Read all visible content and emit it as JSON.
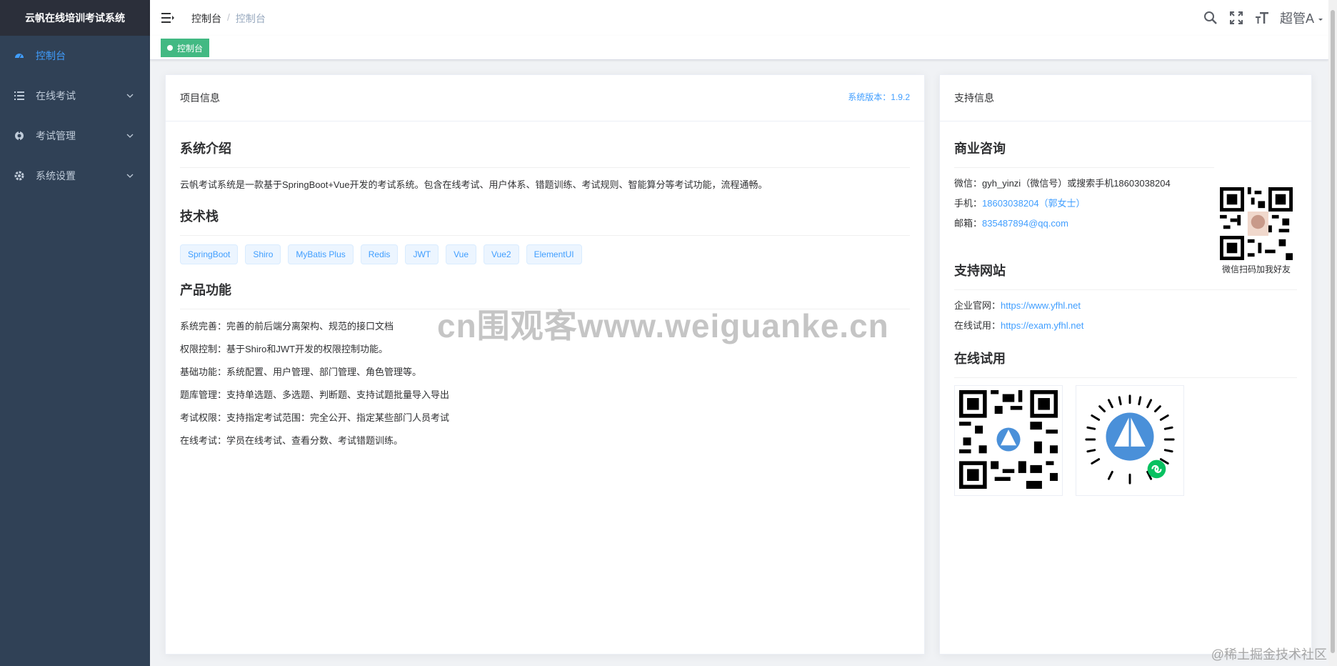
{
  "app": {
    "logo_text": "云帆在线培训考试系统"
  },
  "sidebar": {
    "items": [
      {
        "label": "控制台",
        "icon": "dashboard-icon",
        "active": true
      },
      {
        "label": "在线考试",
        "icon": "list-icon"
      },
      {
        "label": "考试管理",
        "icon": "gear-outline-icon"
      },
      {
        "label": "系统设置",
        "icon": "gear-icon"
      }
    ]
  },
  "navbar": {
    "breadcrumb": [
      "控制台",
      "控制台"
    ],
    "breadcrumb_sep": "/",
    "user_name": "超管A"
  },
  "tags_view": {
    "active_tag": "控制台"
  },
  "project_card": {
    "header": "项目信息",
    "version": "系统版本：1.9.2",
    "intro_title": "系统介绍",
    "intro_text": "云帆考试系统是一款基于SpringBoot+Vue开发的考试系统。包含在线考试、用户体系、错题训练、考试规则、智能算分等考试功能，流程通畅。",
    "tech_title": "技术栈",
    "tech_tags": [
      "SpringBoot",
      "Shiro",
      "MyBatis Plus",
      "Redis",
      "JWT",
      "Vue",
      "Vue2",
      "ElementUI"
    ],
    "features_title": "产品功能",
    "features": [
      "系统完善：完善的前后端分离架构、规范的接口文档",
      "权限控制：基于Shiro和JWT开发的权限控制功能。",
      "基础功能：系统配置、用户管理、部门管理、角色管理等。",
      "题库管理：支持单选题、多选题、判断题、支持试题批量导入导出",
      "考试权限：支持指定考试范围：完全公开、指定某些部门人员考试",
      "在线考试：学员在线考试、查看分数、考试错题训练。"
    ]
  },
  "support_card": {
    "header": "支持信息",
    "business_title": "商业咨询",
    "wechat_line": "微信：gyh_yinzi（微信号）或搜索手机18603038204",
    "phone_label": "手机：",
    "phone_value": "18603038204（郭女士）",
    "email_label": "邮箱：",
    "email_value": "835487894@qq.com",
    "qr_caption": "微信扫码加我好友",
    "sites_title": "支持网站",
    "site1_label": "企业官网：",
    "site1_url": "https://www.yfhl.net",
    "site2_label": "在线试用：",
    "site2_url": "https://exam.yfhl.net",
    "trial_title": "在线试用"
  },
  "overlay": {
    "watermark": "cn围观客www.weiguanke.cn",
    "corner_mark": "@稀土掘金技术社区"
  },
  "colors": {
    "sidebar_bg": "#304156",
    "accent": "#409eff",
    "tag_green": "#42b983"
  }
}
